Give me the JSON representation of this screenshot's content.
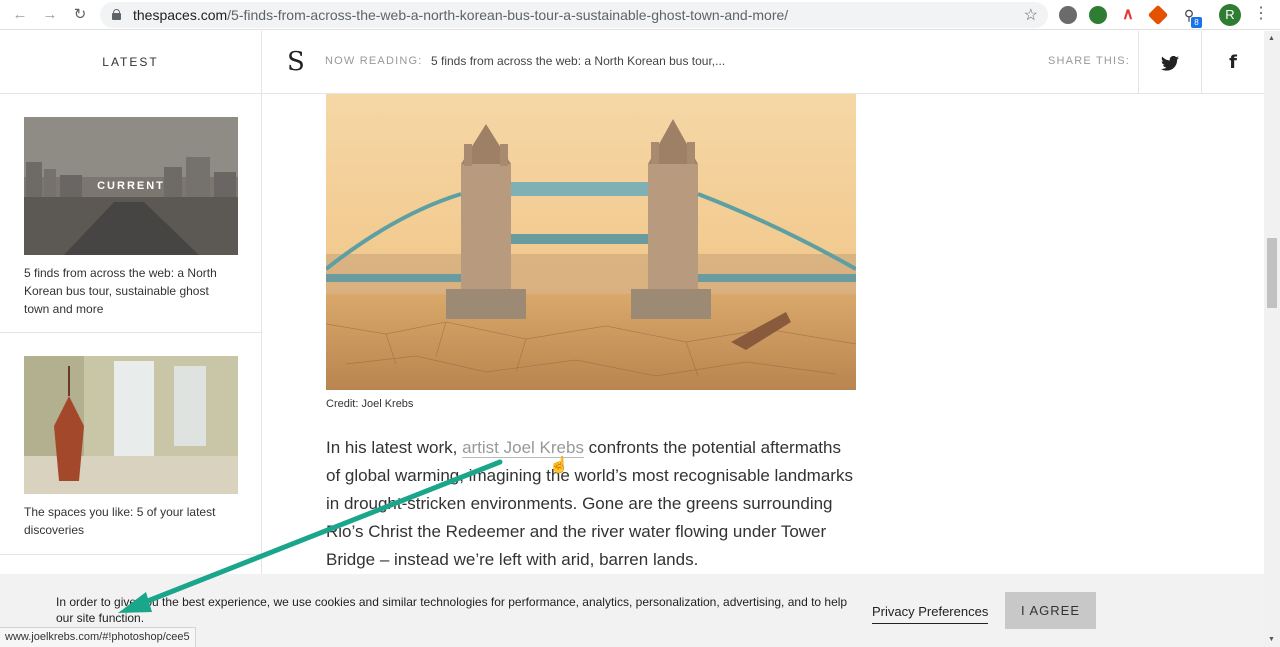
{
  "browser": {
    "url_host": "thespaces.com",
    "url_path": "/5-finds-from-across-the-web-a-north-korean-bus-tour-a-sustainable-ghost-town-and-more/",
    "profile_initial": "R",
    "extension_badge": "8",
    "icons": [
      "back-icon",
      "forward-icon",
      "reload-icon",
      "lock-icon",
      "star-icon",
      "menu-icon"
    ]
  },
  "header": {
    "latest_label": "LATEST",
    "logo": "S",
    "now_reading_label": "NOW READING:",
    "now_reading_title": "5 finds from across the web: a North Korean bus tour,...",
    "share_label": "SHARE THIS:",
    "twitter_glyph": "🐦",
    "facebook_glyph": "f"
  },
  "sidebar": {
    "items": [
      {
        "badge": "CURRENT",
        "title": "5 finds from across the web: a North Korean bus tour, sustainable ghost town and more"
      },
      {
        "title": "The spaces you like: 5 of your latest discoveries"
      }
    ]
  },
  "article": {
    "credit": "Credit: Joel Krebs",
    "para_before_link": "In his latest work, ",
    "link_text": "artist Joel Krebs",
    "para_after_link": " confronts the potential aftermaths of global warming, imagining the world’s most recognisable landmarks in drought-stricken environments. Gone are the greens surrounding Rio’s Christ the Redeemer and the river water flowing under Tower Bridge – instead we’re left with arid, barren lands."
  },
  "cookie": {
    "text": "In order to give you the best experience, we use cookies and similar technologies for performance, analytics, personalization, advertising, and to help our site function.",
    "privacy_label": "Privacy Preferences",
    "agree_label": "I AGREE"
  },
  "status_bar": {
    "url": "www.joelkrebs.com/#!photoshop/cee5"
  },
  "colors": {
    "annotation_arrow": "#1aa68a",
    "link": "#999999"
  }
}
